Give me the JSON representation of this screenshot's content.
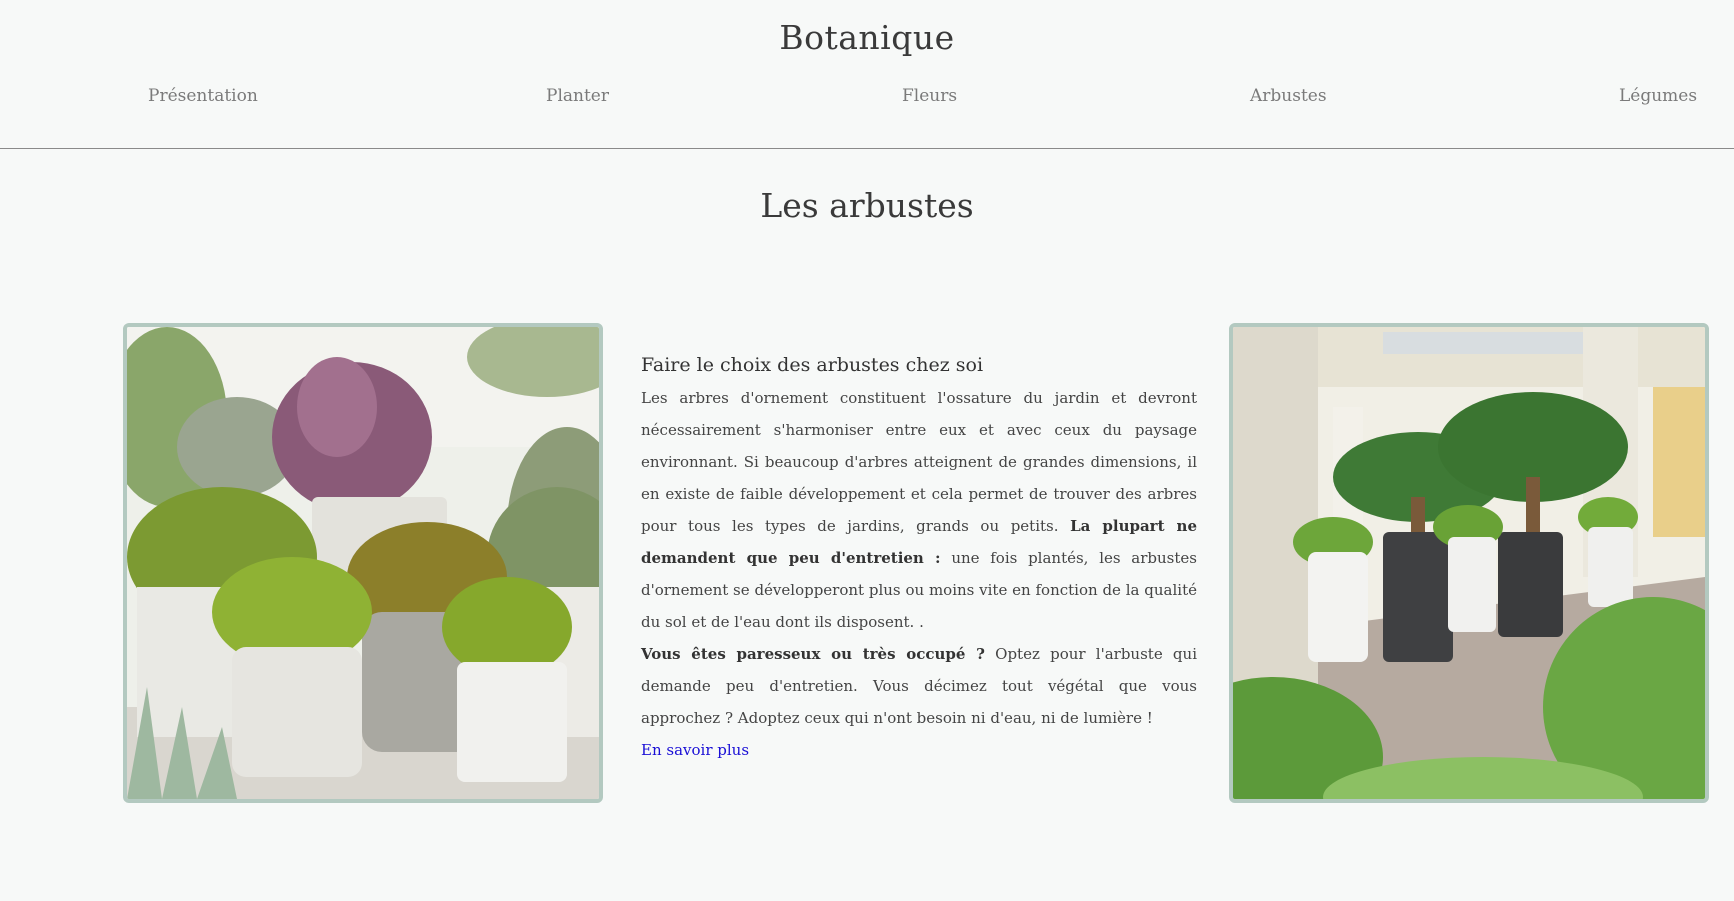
{
  "header": {
    "title": "Botanique",
    "nav": [
      {
        "label": "Présentation"
      },
      {
        "label": "Planter"
      },
      {
        "label": "Fleurs"
      },
      {
        "label": "Arbustes"
      },
      {
        "label": "Légumes"
      }
    ]
  },
  "section": {
    "title": "Les arbustes"
  },
  "article": {
    "heading": "Faire le choix des arbustes chez soi",
    "p1_a": "Les arbres d'ornement constituent l'ossature du jardin et devront nécessairement s'harmoniser entre eux et avec ceux du paysage environnant. Si beaucoup d'arbres atteignent de grandes dimensions, il en existe de faible développement et cela permet de trouver des arbres pour tous les types de jardins, grands ou petits. ",
    "p1_bold": "La plupart ne demandent que peu d'entretien :",
    "p1_b": " une fois plantés, les arbustes d'ornement se développeront plus ou moins vite en fonction de la qualité du sol et de l'eau dont ils disposent. .",
    "p2_bold": "Vous êtes paresseux ou très occupé ?",
    "p2_a": " Optez pour l'arbuste qui demande peu d'entretien. Vous décimez tout végétal que vous approchez ? Adoptez ceux qui n'ont besoin ni d'eau, ni de lumière !",
    "link": "En savoir plus"
  },
  "images": {
    "left": "potted-shrubs-photo",
    "right": "patio-palms-planters-photo"
  },
  "colors": {
    "background": "#f7f9f8",
    "photo_border": "#b3c9c0",
    "link": "#1a0fd6",
    "nav_text": "#7a7a7a"
  }
}
